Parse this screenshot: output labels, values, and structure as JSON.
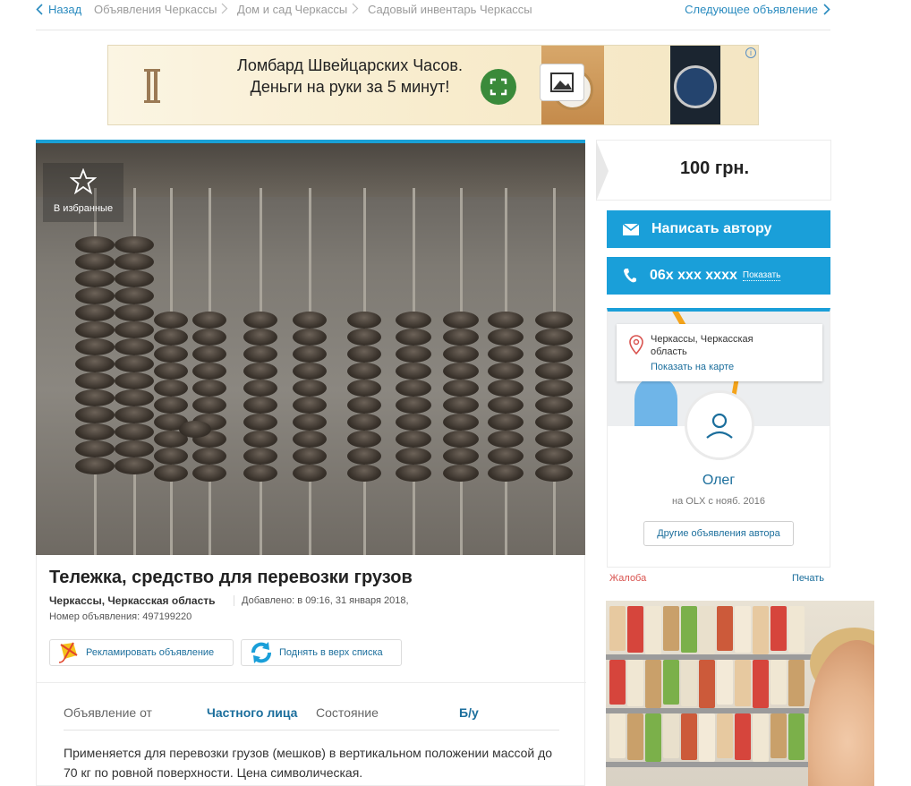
{
  "breadcrumb": {
    "back": "Назад",
    "items": [
      "Объявления Черкассы",
      "Дом и сад Черкассы",
      "Садовый инвентарь Черкассы"
    ],
    "next": "Следующее объявление"
  },
  "banner": {
    "text": "Ломбард Швейцарских Часов. Деньги на руки за 5 минут!",
    "info": "i"
  },
  "gallery": {
    "favorite_label": "В избранные"
  },
  "ad": {
    "title": "Тележка, средство для перевозки грузов",
    "location": "Черкассы, Черкасская область",
    "added": "Добавлено: в 09:16, 31 января 2018,",
    "number": "Номер объявления: 497199220",
    "promote": "Рекламировать объявление",
    "raise": "Поднять в верх списка",
    "props": [
      {
        "key": "Объявление от",
        "value": "Частного лица"
      },
      {
        "key": "Состояние",
        "value": "Б/у"
      }
    ],
    "description": "Применяется для перевозки грузов (мешков) в вертикальном положении массой до 70 кг по ровной поверхности. Цена символическая."
  },
  "sidebar": {
    "price": "100 грн.",
    "write_author": "Написать автору",
    "phone": "06x xxx xxxx",
    "show_phone": "Показать",
    "map": {
      "address": "Черкассы, Черкасская область",
      "show_on_map": "Показать на карте"
    },
    "seller": {
      "name": "Олег",
      "since": "на OLX с нояб. 2016",
      "other_ads": "Другие объявления автора"
    },
    "complain": "Жалоба",
    "print": "Печать"
  },
  "colors": {
    "accent": "#1a9fd9",
    "link": "#1b6e9c",
    "warning": "#d9534f"
  }
}
